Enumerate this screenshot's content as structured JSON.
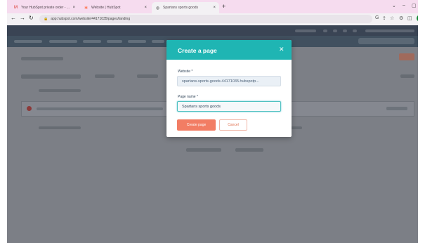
{
  "browser": {
    "tabs": [
      {
        "icon": "gmail-icon",
        "title": "Your HubSpot private order - ..."
      },
      {
        "icon": "hubspot-icon",
        "title": "Website | HubSpot"
      },
      {
        "icon": "globe-icon",
        "title": "Spartans sports goods"
      }
    ],
    "address": "app.hubspot.com/website/44171035/pages/landing",
    "new_tab_glyph": "+",
    "close_glyph": "×"
  },
  "modal": {
    "title": "Create a page",
    "close_glyph": "✕",
    "website_label": "Website *",
    "website_value": "spartans-sports-goods-44171035.hubspotp...",
    "page_name_label": "Page name *",
    "page_name_value": "Spartans sports goods",
    "create_label": "Create page",
    "cancel_label": "Cancel"
  },
  "colors": {
    "modal_header": "#1fb5b3",
    "primary_button": "#f27d64",
    "tab_strip": "#f6dcef",
    "overlay": "#7c7f86"
  }
}
